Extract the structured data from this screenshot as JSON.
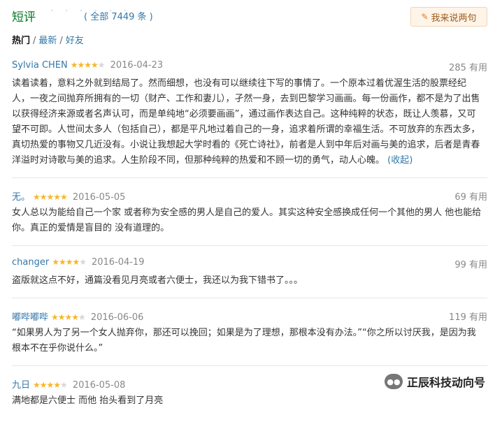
{
  "header": {
    "title": "短评",
    "dots": "· · · · · ·",
    "count_text": "( 全部 7449 条 )",
    "write_button": "我来说两句"
  },
  "filters": {
    "hot": "热门",
    "latest": "最新",
    "friends": "好友"
  },
  "comments": [
    {
      "author": "Sylvia CHEN",
      "stars": "★★★★",
      "stars_off": "★",
      "date": "2016-04-23",
      "votes": "285 有用",
      "text": "读着读着，意料之外就到结局了。然而细想，也没有可以继续往下写的事情了。一个原本过着优渥生活的股票经纪人，一夜之间抛弃所拥有的一切（财产、工作和妻儿），孑然一身，去到巴黎学习画画。每一份画作，都不是为了出售以获得经济来源或者名声认可，而是单纯地“必须要画画”，通过画作表达自己。这种纯粹的状态，既让人羡慕，又可望不可即。人世间太多人（包括自己），都是平凡地过着自己的一身，追求着所谓的幸福生活。不可放弃的东西太多，真切热爱的事物又几近没有。小说让我想起大学时看的《死亡诗社》，前者是人到中年后对画与美的追求，后者是青春洋溢时对诗歌与美的追求。人生阶段不同，但那种纯粹的热爱和不顾一切的勇气，动人心魄。",
      "collapse": "(收起)"
    },
    {
      "author": "无。",
      "stars": "★★★★★",
      "stars_off": "",
      "date": "2016-05-05",
      "votes": "69 有用",
      "text": "女人总以为能给自己一个家 或者称为安全感的男人是自己的爱人。其实这种安全感换成任何一个其他的男人 他也能给你。真正的爱情是盲目的 没有道理的。",
      "collapse": ""
    },
    {
      "author": "changer",
      "stars": "★★★★",
      "stars_off": "★",
      "date": "2016-04-19",
      "votes": "99 有用",
      "text": "盗版就这点不好，通篇没看见月亮或者六便士，我还以为我下错书了。。。",
      "collapse": ""
    },
    {
      "author": "嘟哔嘟哔",
      "stars": "★★★★",
      "stars_off": "★",
      "date": "2016-06-06",
      "votes": "119 有用",
      "text": "“如果男人为了另一个女人抛弃你，那还可以挽回；如果是为了理想，那根本没有办法。”“你之所以讨厌我，是因为我根本不在乎你说什么。”",
      "collapse": ""
    },
    {
      "author": "九日",
      "stars": "★★★★",
      "stars_off": "★",
      "date": "2016-05-08",
      "votes": "",
      "text": "满地都是六便士 而他 抬头看到了月亮",
      "collapse": ""
    }
  ],
  "watermark": {
    "text": "正辰科技动向号"
  }
}
